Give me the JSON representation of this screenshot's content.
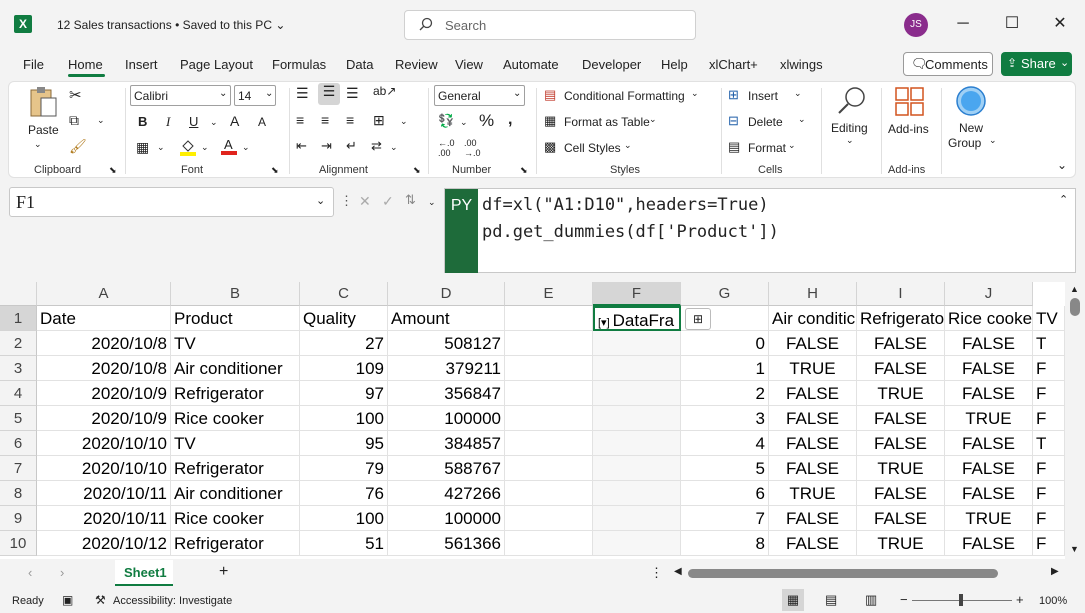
{
  "window": {
    "doc_title": "12 Sales transactions • Saved to this PC",
    "search_placeholder": "Search",
    "user_initials": "JS",
    "minimize": "─",
    "maximize": "☐",
    "close": "✕"
  },
  "menu": {
    "tabs": [
      "File",
      "Home",
      "Insert",
      "Page Layout",
      "Formulas",
      "Data",
      "Review",
      "View",
      "Automate",
      "Developer",
      "Help",
      "xlChart+",
      "xlwings"
    ],
    "active": "Home",
    "comments": "Comments",
    "share": "Share"
  },
  "ribbon": {
    "clipboard": {
      "paste": "Paste",
      "label": "Clipboard"
    },
    "font": {
      "name": "Calibri",
      "size": "14",
      "label": "Font",
      "bold": "B",
      "italic": "I",
      "underline": "U",
      "grow": "A",
      "shrink": "A"
    },
    "alignment": {
      "label": "Alignment"
    },
    "number": {
      "format": "General",
      "label": "Number"
    },
    "styles": {
      "conditional": "Conditional Formatting",
      "table": "Format as Table",
      "cell": "Cell Styles",
      "label": "Styles"
    },
    "cells": {
      "insert": "Insert",
      "delete": "Delete",
      "format": "Format",
      "label": "Cells"
    },
    "editing": {
      "label": "Editing"
    },
    "addins": {
      "button": "Add-ins",
      "label": "Add-ins"
    },
    "newgroup": {
      "line1": "New",
      "line2": "Group"
    }
  },
  "formula_bar": {
    "name_box": "F1",
    "badge": "PY",
    "line1": "df=xl(\"A1:D10\",headers=True)",
    "line2": "pd.get_dummies(df['Product'])"
  },
  "grid": {
    "columns": [
      "A",
      "B",
      "C",
      "D",
      "E",
      "F",
      "G",
      "H",
      "I",
      "J"
    ],
    "rows": [
      "1",
      "2",
      "3",
      "4",
      "5",
      "6",
      "7",
      "8",
      "9",
      "10"
    ],
    "header_row": {
      "A": "Date",
      "B": "Product",
      "C": "Quality",
      "D": "Amount",
      "F": "DataFra",
      "H": "Air conditic",
      "I": "Refrigerato",
      "J": "Rice cooker",
      "K": "TV"
    },
    "data": [
      {
        "A": "2020/10/8",
        "B": "TV",
        "C": "27",
        "D": "508127",
        "G": "0",
        "H": "FALSE",
        "I": "FALSE",
        "J": "FALSE",
        "K": "T"
      },
      {
        "A": "2020/10/8",
        "B": "Air conditioner",
        "C": "109",
        "D": "379211",
        "G": "1",
        "H": "TRUE",
        "I": "FALSE",
        "J": "FALSE",
        "K": "F"
      },
      {
        "A": "2020/10/9",
        "B": "Refrigerator",
        "C": "97",
        "D": "356847",
        "G": "2",
        "H": "FALSE",
        "I": "TRUE",
        "J": "FALSE",
        "K": "F"
      },
      {
        "A": "2020/10/9",
        "B": "Rice cooker",
        "C": "100",
        "D": "100000",
        "G": "3",
        "H": "FALSE",
        "I": "FALSE",
        "J": "TRUE",
        "K": "F"
      },
      {
        "A": "2020/10/10",
        "B": "TV",
        "C": "95",
        "D": "384857",
        "G": "4",
        "H": "FALSE",
        "I": "FALSE",
        "J": "FALSE",
        "K": "T"
      },
      {
        "A": "2020/10/10",
        "B": "Refrigerator",
        "C": "79",
        "D": "588767",
        "G": "5",
        "H": "FALSE",
        "I": "TRUE",
        "J": "FALSE",
        "K": "F"
      },
      {
        "A": "2020/10/11",
        "B": "Air conditioner",
        "C": "76",
        "D": "427266",
        "G": "6",
        "H": "TRUE",
        "I": "FALSE",
        "J": "FALSE",
        "K": "F"
      },
      {
        "A": "2020/10/11",
        "B": "Rice cooker",
        "C": "100",
        "D": "100000",
        "G": "7",
        "H": "FALSE",
        "I": "FALSE",
        "J": "TRUE",
        "K": "F"
      },
      {
        "A": "2020/10/12",
        "B": "Refrigerator",
        "C": "51",
        "D": "561366",
        "G": "8",
        "H": "FALSE",
        "I": "TRUE",
        "J": "FALSE",
        "K": "F"
      }
    ]
  },
  "sheets": {
    "active": "Sheet1",
    "add": "+"
  },
  "status": {
    "ready": "Ready",
    "accessibility": "Accessibility: Investigate",
    "zoom": "100%"
  },
  "colors": {
    "accent": "#107c41",
    "py_badge": "#1e6b3a"
  }
}
